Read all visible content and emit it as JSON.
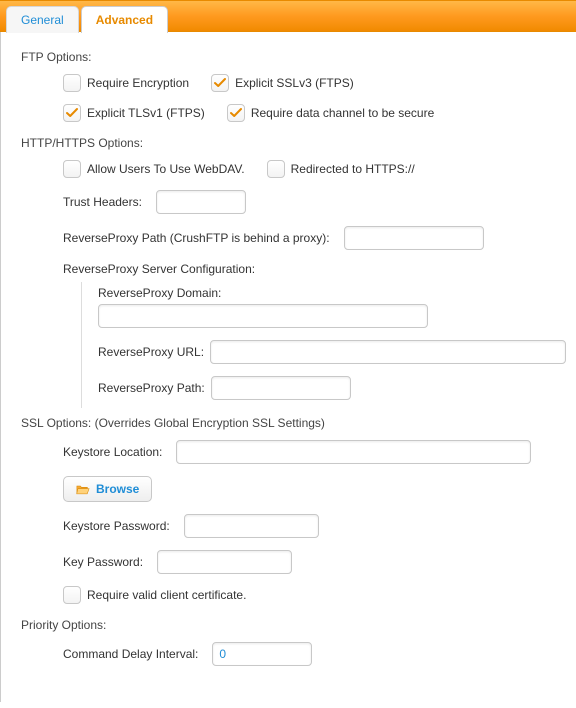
{
  "tabs": {
    "general": "General",
    "advanced": "Advanced"
  },
  "ftp": {
    "section": "FTP Options:",
    "require_encryption": "Require Encryption",
    "explicit_sslv3": "Explicit SSLv3 (FTPS)",
    "explicit_tlsv1": "Explicit TLSv1 (FTPS)",
    "require_data_secure": "Require data channel to be secure"
  },
  "http": {
    "section": "HTTP/HTTPS Options:",
    "allow_webdav": "Allow Users To Use WebDAV.",
    "redirected_https": "Redirected to HTTPS://",
    "trust_headers_label": "Trust Headers:",
    "trust_headers_value": "",
    "rp_path_label": "ReverseProxy Path (CrushFTP is behind a proxy):",
    "rp_path_value": "",
    "rp_server_config": "ReverseProxy Server Configuration:",
    "rp_domain_label": "ReverseProxy Domain:",
    "rp_domain_value": "",
    "rp_url_label": "ReverseProxy URL:",
    "rp_url_value": "",
    "rp_path2_label": "ReverseProxy Path:",
    "rp_path2_value": ""
  },
  "ssl": {
    "section": "SSL Options: (Overrides Global Encryption SSL Settings)",
    "keystore_location_label": "Keystore Location:",
    "keystore_location_value": "",
    "browse": "Browse",
    "keystore_password_label": "Keystore Password:",
    "keystore_password_value": "",
    "key_password_label": "Key Password:",
    "key_password_value": "",
    "require_valid_cert": "Require valid client certificate."
  },
  "priority": {
    "section": "Priority Options:",
    "command_delay_label": "Command Delay Interval:",
    "command_delay_value": "0"
  }
}
